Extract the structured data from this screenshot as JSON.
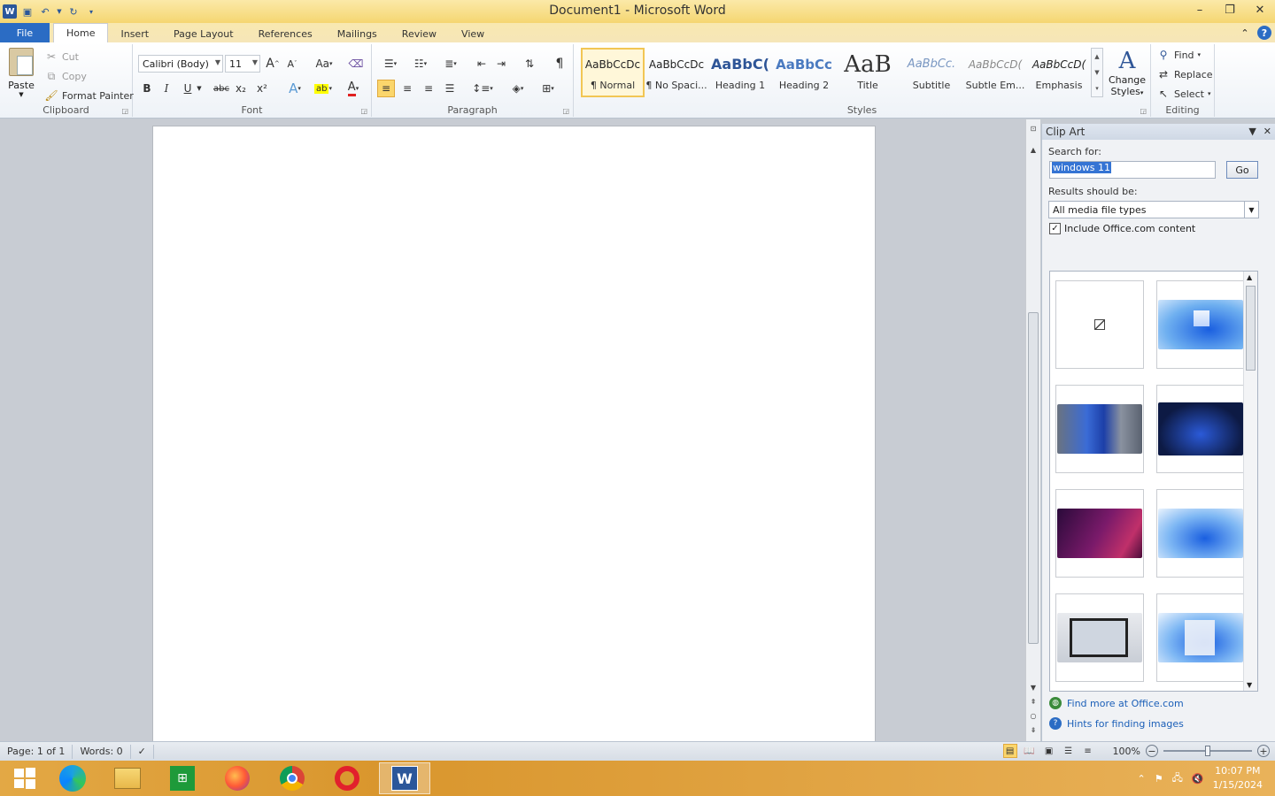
{
  "window": {
    "title": "Document1  -  Microsoft Word"
  },
  "tabs": [
    {
      "label": "File"
    },
    {
      "label": "Home"
    },
    {
      "label": "Insert"
    },
    {
      "label": "Page Layout"
    },
    {
      "label": "References"
    },
    {
      "label": "Mailings"
    },
    {
      "label": "Review"
    },
    {
      "label": "View"
    }
  ],
  "clipboard": {
    "paste_label": "Paste",
    "cut_label": "Cut",
    "copy_label": "Copy",
    "format_painter_label": "Format Painter",
    "group_label": "Clipboard"
  },
  "font": {
    "font_name": "Calibri (Body)",
    "font_size": "11",
    "bold": "B",
    "italic": "I",
    "underline": "U",
    "strikethrough": "abc",
    "subscript": "x₂",
    "superscript": "x²",
    "grow": "A",
    "shrink": "A",
    "change_case": "Aa",
    "group_label": "Font"
  },
  "paragraph": {
    "group_label": "Paragraph",
    "pilcrow": "¶"
  },
  "styles": {
    "group_label": "Styles",
    "items": [
      {
        "preview": "AaBbCcDc",
        "name": "¶ Normal"
      },
      {
        "preview": "AaBbCcDc",
        "name": "¶ No Spaci..."
      },
      {
        "preview": "AaBbC(",
        "name": "Heading 1"
      },
      {
        "preview": "AaBbCc",
        "name": "Heading 2"
      },
      {
        "preview": "AaB",
        "name": "Title"
      },
      {
        "preview": "AaBbCc.",
        "name": "Subtitle"
      },
      {
        "preview": "AaBbCcD(",
        "name": "Subtle Em..."
      },
      {
        "preview": "AaBbCcD(",
        "name": "Emphasis"
      }
    ],
    "change_styles_line1": "Change",
    "change_styles_line2": "Styles"
  },
  "editing": {
    "group_label": "Editing",
    "find_label": "Find",
    "replace_label": "Replace",
    "select_label": "Select"
  },
  "clip_art": {
    "title": "Clip Art",
    "search_label": "Search for:",
    "search_value": "windows 11",
    "go_label": "Go",
    "results_label": "Results should be:",
    "media_type": "All media file types",
    "include_label": "Include Office.com content",
    "include_checked": true,
    "find_more_label": "Find more at Office.com",
    "hints_label": "Hints for finding images"
  },
  "status": {
    "page": "Page: 1 of 1",
    "words": "Words: 0",
    "zoom": "100%"
  },
  "taskbar": {
    "time": "10:07 PM",
    "date": "1/15/2024"
  },
  "colors": {
    "accent": "#2b6cc4",
    "titlebar": "#f5d671",
    "taskbar": "#d9962d"
  }
}
